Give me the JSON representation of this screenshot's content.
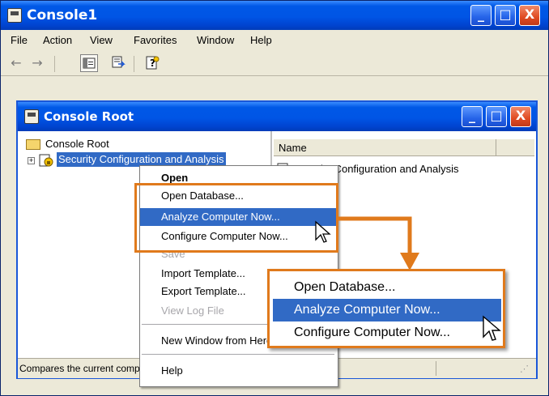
{
  "window": {
    "title": "Console1",
    "controls": {
      "minimize": "_",
      "maximize": "□",
      "close": "X"
    }
  },
  "menubar": {
    "items": [
      "File",
      "Action",
      "View",
      "Favorites",
      "Window",
      "Help"
    ]
  },
  "toolbar": {
    "icons": [
      "back-arrow-icon",
      "forward-arrow-icon",
      "show-hide-tree-icon",
      "export-list-icon",
      "help-icon"
    ]
  },
  "inner_window": {
    "title": "Console Root",
    "tree": {
      "root": "Console Root",
      "child": "Security Configuration and Analysis"
    },
    "list": {
      "column_name": "Name",
      "row": "Security Configuration and Analysis"
    },
    "status": "Compares the current computer settings against"
  },
  "context_menu": {
    "items": [
      {
        "label": "Open",
        "bold": true
      },
      {
        "label": "Open Database..."
      },
      {
        "label": "Analyze Computer Now...",
        "selected": true
      },
      {
        "label": "Configure Computer Now..."
      },
      {
        "label": "Save",
        "disabled": true
      },
      {
        "label": "Import Template..."
      },
      {
        "label": "Export Template..."
      },
      {
        "label": "View Log File",
        "disabled": true
      },
      {
        "label": "New Window from Here"
      },
      {
        "label": "Help"
      }
    ]
  },
  "callout": {
    "items": [
      "Open Database...",
      "Analyze Computer Now...",
      "Configure Computer Now..."
    ]
  },
  "colors": {
    "title_blue": "#0055e5",
    "highlight": "#316ac5",
    "callout_orange": "#e07a1c",
    "chrome": "#ece9d8"
  }
}
